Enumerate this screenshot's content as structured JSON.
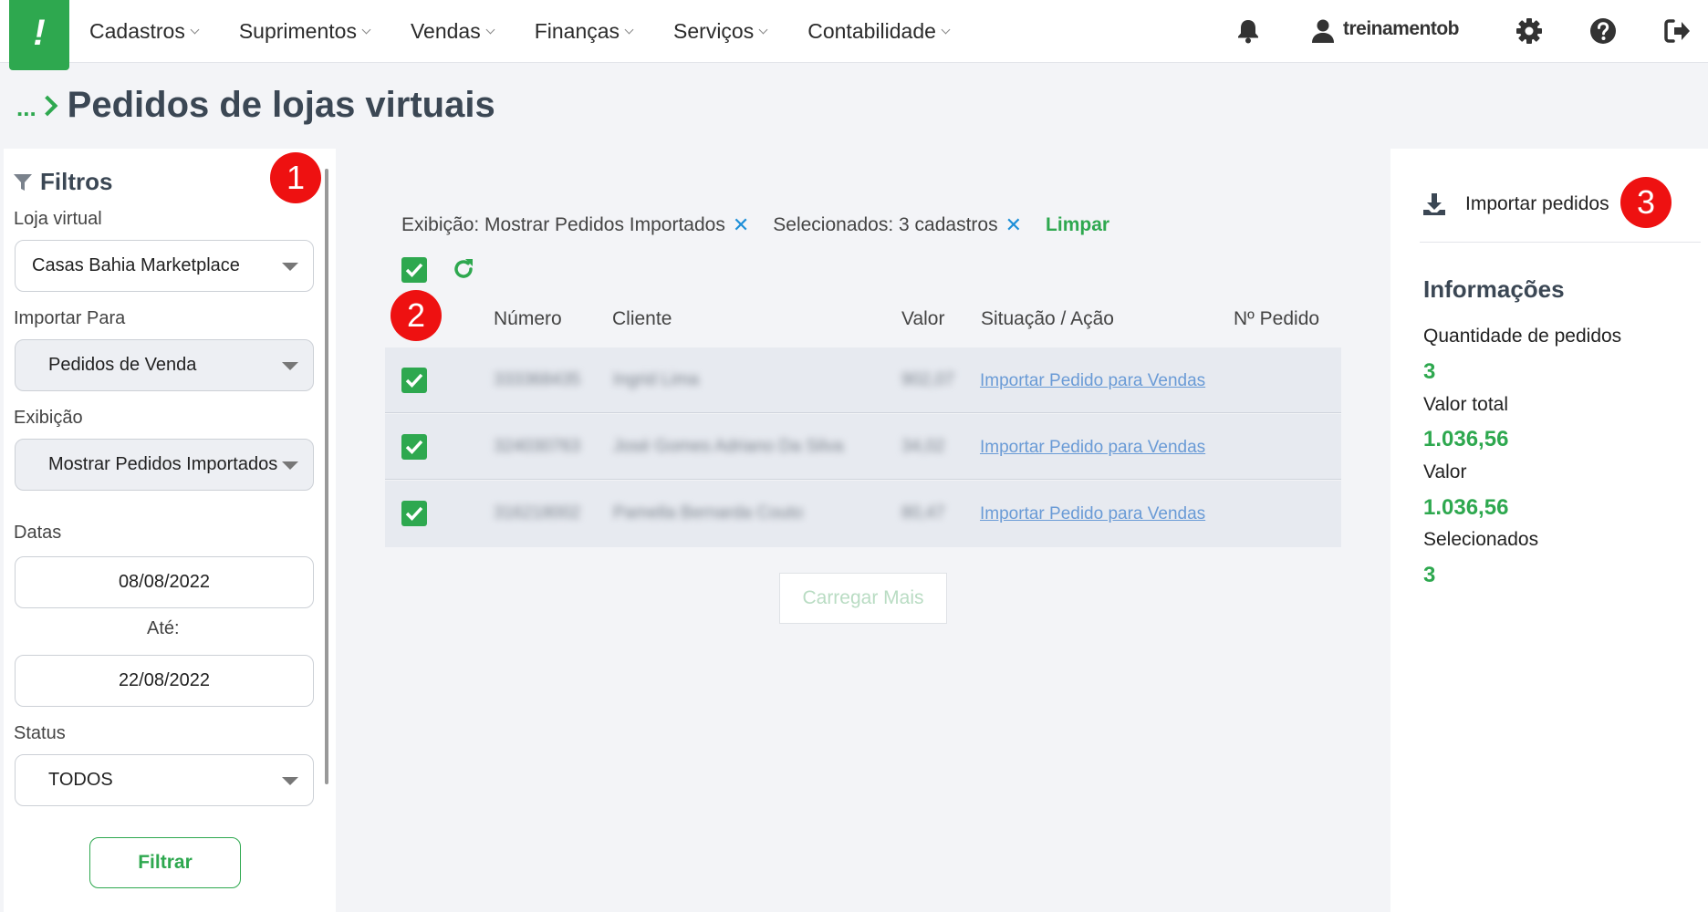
{
  "nav": {
    "logo_text": "!",
    "menu": [
      {
        "label": "Cadastros"
      },
      {
        "label": "Suprimentos"
      },
      {
        "label": "Vendas"
      },
      {
        "label": "Finanças"
      },
      {
        "label": "Serviços"
      },
      {
        "label": "Contabilidade"
      }
    ],
    "user": "treinamentob",
    "icons": [
      "bell-icon",
      "user-icon",
      "gear-icon",
      "help-icon",
      "logout-icon"
    ]
  },
  "breadcrumb": {
    "dots": "...",
    "title": "Pedidos de lojas virtuais"
  },
  "filters": {
    "title": "Filtros",
    "loja_label": "Loja virtual",
    "loja_value": "Casas Bahia Marketplace",
    "importar_label": "Importar Para",
    "importar_value": "Pedidos de Venda",
    "exibicao_label": "Exibição",
    "exibicao_value": "Mostrar Pedidos Importados",
    "datas_label": "Datas",
    "date_from": "08/08/2022",
    "ate_label": "Até:",
    "date_to": "22/08/2022",
    "status_label": "Status",
    "status_value": "TODOS",
    "filter_button": "Filtrar"
  },
  "badges": {
    "one": "1",
    "two": "2",
    "three": "3"
  },
  "chips": {
    "exibicao": "Exibição: Mostrar Pedidos Importados",
    "selecionados": "Selecionados: 3 cadastros",
    "clear": "Limpar",
    "remove_symbol": "✕"
  },
  "table": {
    "headers": {
      "numero": "Número",
      "cliente": "Cliente",
      "valor": "Valor",
      "situacao": "Situação / Ação",
      "pedido": "Nº Pedido"
    },
    "rows": [
      {
        "numero": "333368435",
        "cliente": "Ingrid Lima",
        "valor": "902,07",
        "acao": "Importar Pedido para Vendas"
      },
      {
        "numero": "324030763",
        "cliente": "José Gomes Adriano Da Silva",
        "valor": "34,02",
        "acao": "Importar Pedido para Vendas"
      },
      {
        "numero": "316218002",
        "cliente": "Pamella Bernarda Couto",
        "valor": "80,47",
        "acao": "Importar Pedido para Vendas"
      }
    ],
    "load_more": "Carregar Mais"
  },
  "info": {
    "import_button": "Importar pedidos",
    "title": "Informações",
    "qtd_label": "Quantidade de pedidos",
    "qtd_value": "3",
    "valor_total_label": "Valor total",
    "valor_total_value": "1.036,56",
    "valor_label": "Valor",
    "valor_value": "1.036,56",
    "selecionados_label": "Selecionados",
    "selecionados_value": "3"
  },
  "colors": {
    "accent": "#2ea84f",
    "link": "#6a9bd6",
    "badge": "#ee1111",
    "chip_x": "#1d8fd8"
  }
}
